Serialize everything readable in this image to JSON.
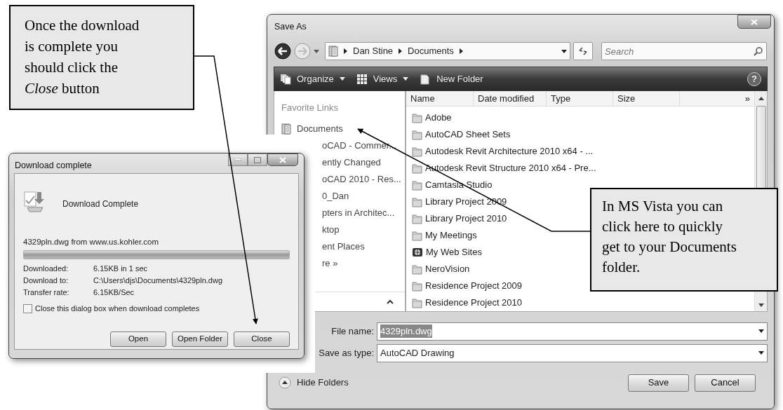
{
  "callouts": [
    {
      "lines": [
        "Once the download",
        "is complete you",
        "should click the",
        "*Close* button"
      ]
    },
    {
      "lines": [
        "In MS Vista you can",
        "click here to quickly",
        "get to your Documents",
        "folder."
      ]
    }
  ],
  "save_as": {
    "title": "Save As",
    "breadcrumb": [
      "Dan Stine",
      "Documents"
    ],
    "search": {
      "placeholder": "Search"
    },
    "toolbar": [
      {
        "label": "Organize",
        "dropdown": true
      },
      {
        "label": "Views",
        "dropdown": true
      },
      {
        "label": "New Folder",
        "dropdown": false
      }
    ],
    "help": "?",
    "favorites_heading": "Favorite Links",
    "favorites": [
      {
        "label": "Documents",
        "kind": "link"
      },
      {
        "label": "oCAD - Commer...",
        "kind": "clipped"
      },
      {
        "label": "ently Changed",
        "kind": "clipped"
      },
      {
        "label": "oCAD 2010 - Res...",
        "kind": "clipped"
      },
      {
        "label": "0_Dan",
        "kind": "clipped"
      },
      {
        "label": "pters in Architec...",
        "kind": "clipped"
      },
      {
        "label": "ktop",
        "kind": "clipped"
      },
      {
        "label": "ent Places",
        "kind": "clipped"
      },
      {
        "label": "re »",
        "kind": "clipped"
      }
    ],
    "columns": [
      "Name",
      "Date modified",
      "Type",
      "Size",
      "»"
    ],
    "files": [
      {
        "name": "Adobe",
        "kind": "folder"
      },
      {
        "name": "AutoCAD Sheet Sets",
        "kind": "folder"
      },
      {
        "name": "Autodesk Revit Architecture 2010 x64 - ...",
        "kind": "folder"
      },
      {
        "name": "Autodesk Revit Structure 2010 x64 - Pre...",
        "kind": "folder"
      },
      {
        "name": "Camtasia Studio",
        "kind": "folder"
      },
      {
        "name": "Library Project 2009",
        "kind": "folder"
      },
      {
        "name": "Library Project 2010",
        "kind": "folder"
      },
      {
        "name": "My Meetings",
        "kind": "folder"
      },
      {
        "name": "My Web Sites",
        "kind": "web"
      },
      {
        "name": "NeroVision",
        "kind": "folder"
      },
      {
        "name": "Residence Project 2009",
        "kind": "folder"
      },
      {
        "name": "Residence Project 2010",
        "kind": "folder"
      }
    ],
    "file_name": {
      "label": "File name:",
      "value": "4329pln.dwg"
    },
    "save_type": {
      "label": "Save as type:",
      "value": "AutoCAD Drawing"
    },
    "hide_folders": "Hide Folders",
    "buttons": [
      "Save",
      "Cancel"
    ]
  },
  "download": {
    "title": "Download complete",
    "heading": "Download Complete",
    "source": "4329pln.dwg from www.us.kohler.com",
    "progress": {
      "level": 1
    },
    "details": [
      {
        "label": "Downloaded:",
        "value": "6.15KB in 1 sec"
      },
      {
        "label": "Download to:",
        "value": "C:\\Users\\djs\\Documents\\4329pln.dwg"
      },
      {
        "label": "Transfer rate:",
        "value": "6.15KB/Sec"
      }
    ],
    "checkbox": {
      "label": "Close this dialog box when download completes",
      "checked": false
    },
    "buttons": [
      "Open",
      "Open Folder",
      "Close"
    ]
  }
}
